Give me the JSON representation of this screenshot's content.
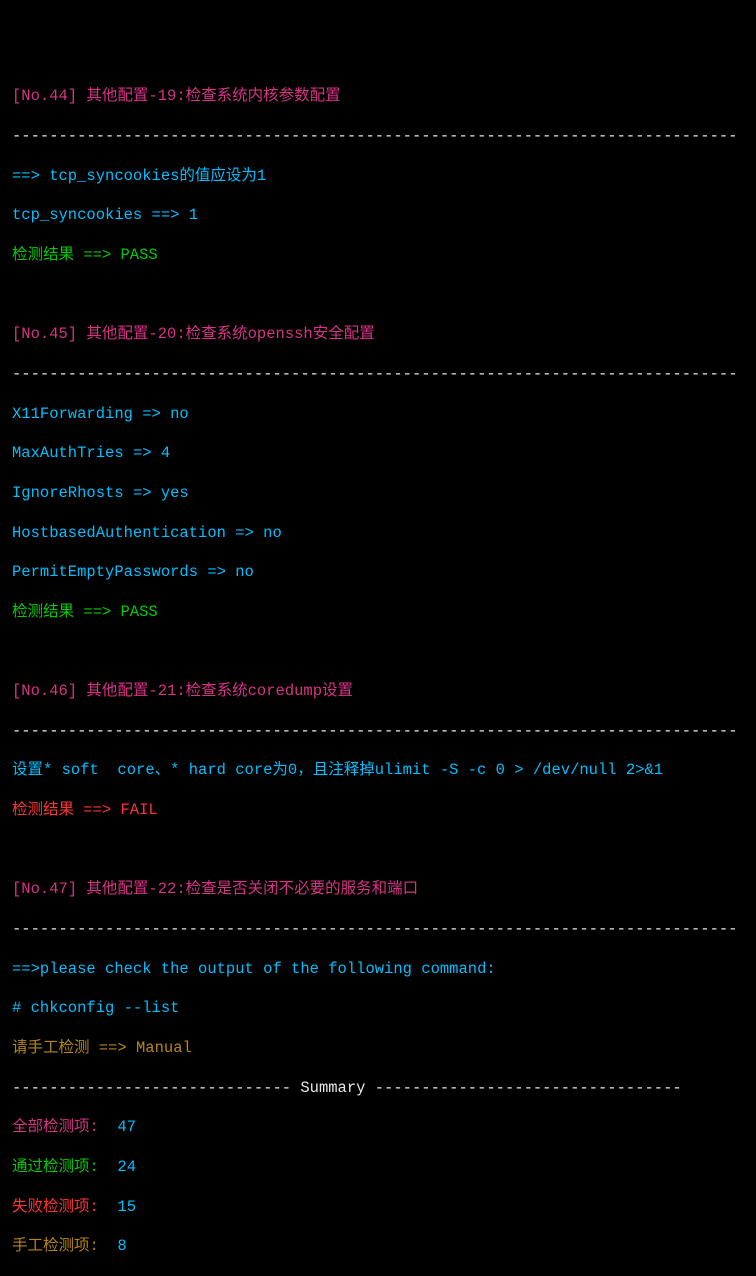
{
  "checks": [
    {
      "header": "[No.44] 其他配置-19:检查系统内核参数配置",
      "dashes1": "------------------------------------------------------------------------------",
      "lines": [
        "==> tcp_syncookies的值应设为1",
        "tcp_syncookies ==> 1"
      ],
      "result_label": "检测结果 ==> PASS",
      "result_class": "green"
    },
    {
      "header": "[No.45] 其他配置-20:检查系统openssh安全配置",
      "dashes1": "------------------------------------------------------------------------------",
      "lines": [
        "X11Forwarding => no",
        "MaxAuthTries => 4",
        "IgnoreRhosts => yes",
        "HostbasedAuthentication => no",
        "PermitEmptyPasswords => no"
      ],
      "result_label": "检测结果 ==> PASS",
      "result_class": "green"
    },
    {
      "header": "[No.46] 其他配置-21:检查系统coredump设置",
      "dashes1": "------------------------------------------------------------------------------",
      "lines": [
        "设置* soft  core、* hard core为0，且注释掉ulimit -S -c 0 > /dev/null 2>&1"
      ],
      "result_label": "检测结果 ==> FAIL",
      "result_class": "red"
    },
    {
      "header": "[No.47] 其他配置-22:检查是否关闭不必要的服务和端口",
      "dashes1": "------------------------------------------------------------------------------",
      "lines": [
        "==>please check the output of the following command:",
        "# chkconfig --list"
      ],
      "result_label": "请手工检测 ==> Manual",
      "result_class": "olive"
    }
  ],
  "summary_divider": "------------------------------ Summary ---------------------------------",
  "summary": {
    "total": {
      "label": "全部检测项:  ",
      "value": "47"
    },
    "pass": {
      "label": "通过检测项:  ",
      "value": "24"
    },
    "fail": {
      "label": "失败检测项:  ",
      "value": "15"
    },
    "manual": {
      "label": "手工检测项:  ",
      "value": "8"
    }
  },
  "blank": " "
}
